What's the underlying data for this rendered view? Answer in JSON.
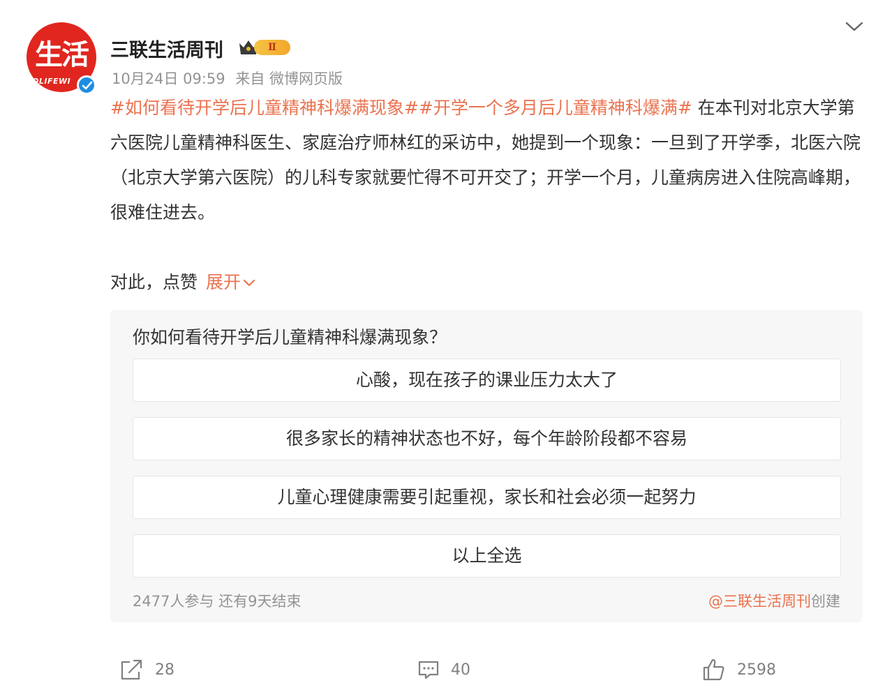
{
  "author": {
    "name": "三联生活周刊",
    "avatar_text": "生活",
    "avatar_band": "OLIFEWI",
    "vip_level": "Ⅱ",
    "verified": true
  },
  "meta": {
    "time": "10月24日 09:59",
    "source": "来自 微博网页版"
  },
  "post": {
    "hashtag1": "#如何看待开学后儿童精神科爆满现象#",
    "hashtag2": "#开学一个多月后儿童精神科爆满#",
    "text": " 在本刊对北京大学第六医院儿童精神科医生、家庭治疗师林红的采访中，她提到一个现象：一旦到了开学季，北医六院（北京大学第六医院）的儿科专家就要忙得不可开交了；开学一个月，儿童病房进入住院高峰期，很难住进去。",
    "more_text": "对此，点赞",
    "expand_label": "展开"
  },
  "poll": {
    "question": "你如何看待开学后儿童精神科爆满现象？",
    "options": [
      "心酸，现在孩子的课业压力太大了",
      "很多家长的精神状态也不好，每个年龄阶段都不容易",
      "儿童心理健康需要引起重视，家长和社会必须一起努力",
      "以上全选"
    ],
    "participants": "2477人参与",
    "remaining": "还有9天结束",
    "creator": "@三联生活周刊",
    "created_suffix": "创建"
  },
  "actions": {
    "repost_count": "28",
    "comment_count": "40",
    "like_count": "2598"
  },
  "colors": {
    "accent": "#eb7350",
    "brand_red": "#e0261f",
    "verified_blue": "#1e8de0",
    "meta_gray": "#939393"
  },
  "icons": [
    "chevron-down-icon",
    "verified-icon",
    "crown-icon",
    "repost-icon",
    "comment-icon",
    "like-icon"
  ]
}
